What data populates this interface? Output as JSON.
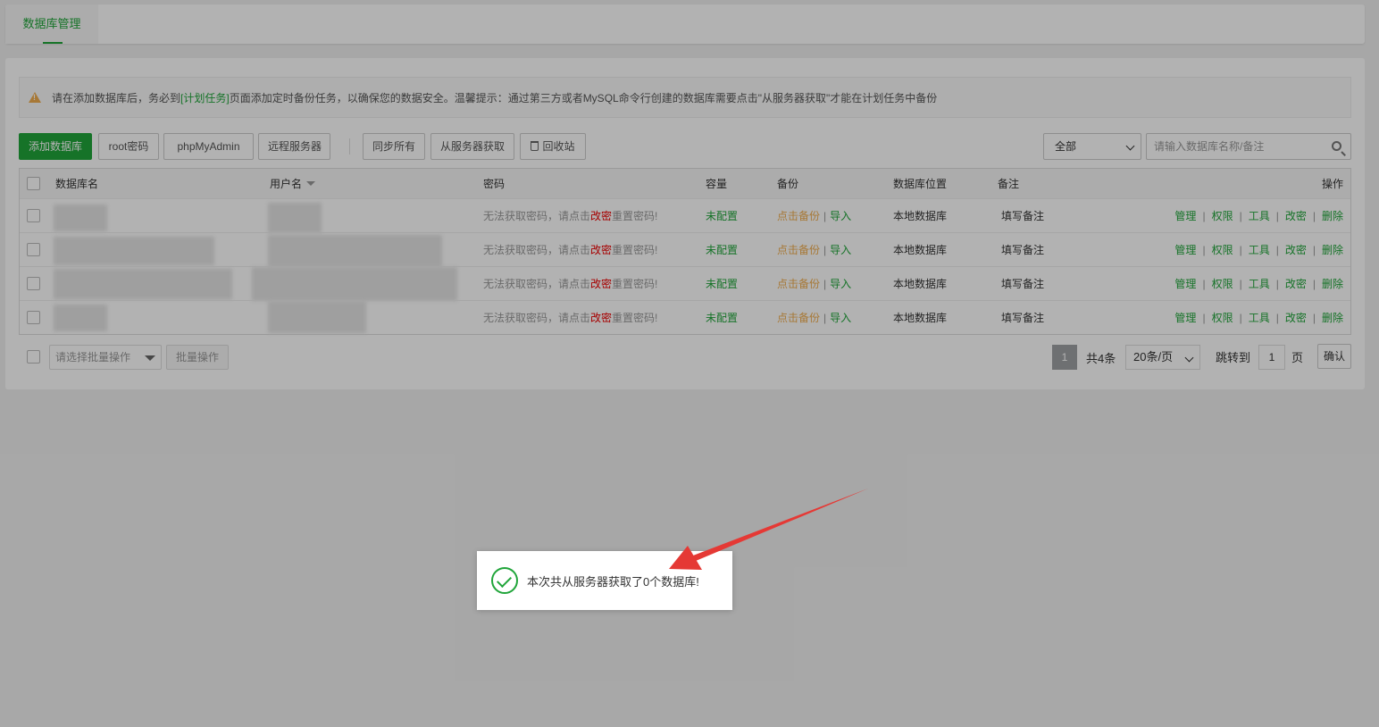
{
  "tabs": [
    {
      "label": "数据库管理"
    }
  ],
  "notice": {
    "before": "请在添加数据库后，务必到",
    "link": "[计划任务]",
    "after": "页面添加定时备份任务，以确保您的数据安全。温馨提示：通过第三方或者MySQL命令行创建的数据库需要点击\"从服务器获取\"才能在计划任务中备份"
  },
  "toolbar": {
    "add_db": "添加数据库",
    "root_pwd": "root密码",
    "phpmyadmin": "phpMyAdmin",
    "remote_server": "远程服务器",
    "sync_all": "同步所有",
    "fetch_from_server": "从服务器获取",
    "recycle_bin": "回收站",
    "filter_value": "全部",
    "search_placeholder": "请输入数据库名称/备注"
  },
  "table": {
    "headers": {
      "name": "数据库名",
      "user": "用户名",
      "password": "密码",
      "capacity": "容量",
      "backup": "备份",
      "location": "数据库位置",
      "remark": "备注",
      "ops": "操作"
    },
    "rows": [
      {
        "pwd_prefix": "无法获取密码，请点击",
        "pwd_link": "改密",
        "pwd_suffix": "重置密码!",
        "capacity": "未配置",
        "backup": "点击备份",
        "import": "导入",
        "location": "本地数据库",
        "remark": "填写备注"
      },
      {
        "pwd_prefix": "无法获取密码，请点击",
        "pwd_link": "改密",
        "pwd_suffix": "重置密码!",
        "capacity": "未配置",
        "backup": "点击备份",
        "import": "导入",
        "location": "本地数据库",
        "remark": "填写备注"
      },
      {
        "pwd_prefix": "无法获取密码，请点击",
        "pwd_link": "改密",
        "pwd_suffix": "重置密码!",
        "capacity": "未配置",
        "backup": "点击备份",
        "import": "导入",
        "location": "本地数据库",
        "remark": "填写备注"
      },
      {
        "pwd_prefix": "无法获取密码，请点击",
        "pwd_link": "改密",
        "pwd_suffix": "重置密码!",
        "capacity": "未配置",
        "backup": "点击备份",
        "import": "导入",
        "location": "本地数据库",
        "remark": "填写备注"
      }
    ],
    "ops": {
      "manage": "管理",
      "perm": "权限",
      "tools": "工具",
      "change_pwd": "改密",
      "delete": "删除"
    }
  },
  "footer": {
    "batch_placeholder": "请选择批量操作",
    "batch_button": "批量操作",
    "current_page": "1",
    "total": "共4条",
    "page_size": "20条/页",
    "jump_label": "跳转到",
    "jump_value": "1",
    "page_label": "页",
    "confirm": "确认"
  },
  "toast": {
    "message": "本次共从服务器获取了0个数据库!"
  },
  "colors": {
    "brand": "#20a53a",
    "warning": "#f0ad4e",
    "danger": "#e00000",
    "arrow": "#e53935"
  }
}
